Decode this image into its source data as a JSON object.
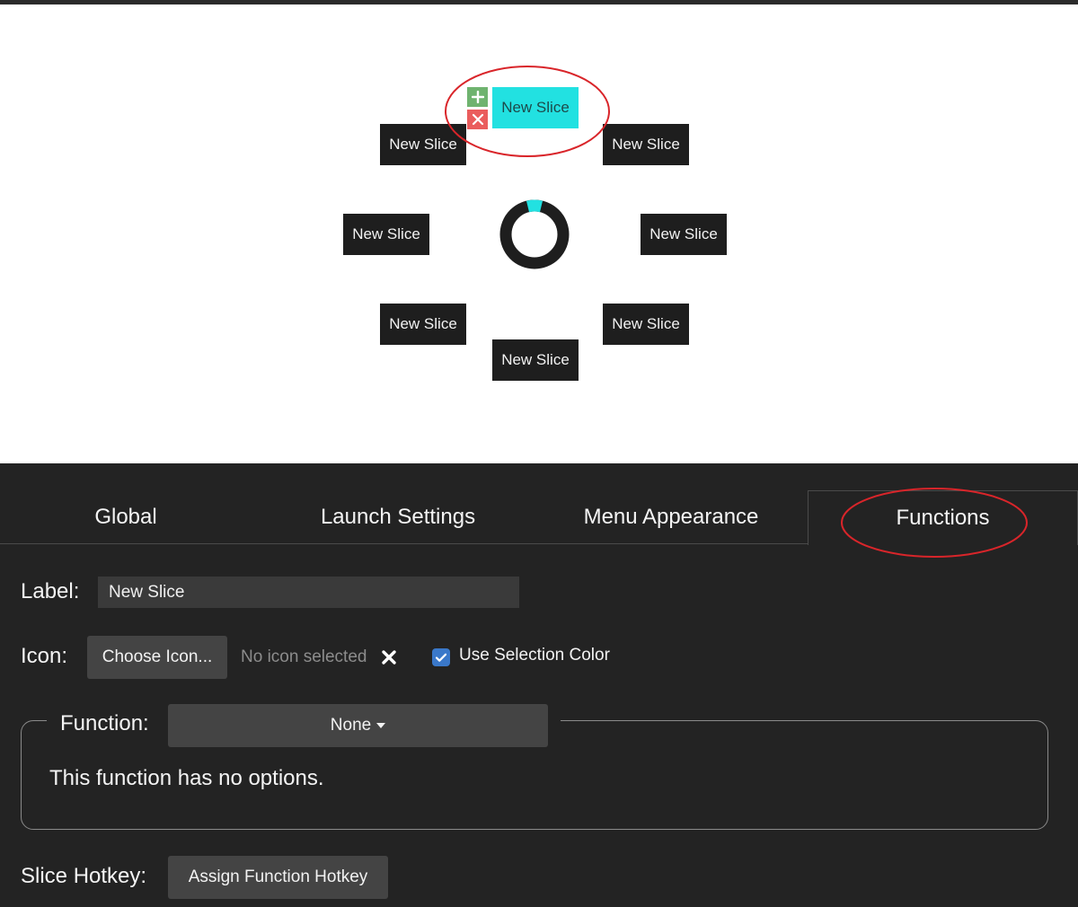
{
  "pie_menu": {
    "slices": [
      {
        "label": "New Slice",
        "selected": true
      },
      {
        "label": "New Slice"
      },
      {
        "label": "New Slice"
      },
      {
        "label": "New Slice"
      },
      {
        "label": "New Slice"
      },
      {
        "label": "New Slice"
      },
      {
        "label": "New Slice"
      },
      {
        "label": "New Slice"
      }
    ],
    "tools": {
      "add_icon": "plus-icon",
      "remove_icon": "close-icon"
    },
    "colors": {
      "selection": "#22e1e1",
      "slice_bg": "#1e1e1e",
      "ring": "#1e1e1e",
      "annotation": "#d9252a"
    }
  },
  "tabs": [
    {
      "label": "Global"
    },
    {
      "label": "Launch Settings"
    },
    {
      "label": "Menu Appearance"
    },
    {
      "label": "Functions",
      "active": true
    }
  ],
  "form": {
    "label_caption": "Label:",
    "label_value": "New Slice",
    "icon_caption": "Icon:",
    "choose_icon_button": "Choose Icon...",
    "no_icon_text": "No icon selected",
    "use_selection_color_label": "Use Selection Color",
    "use_selection_color_checked": true,
    "function_caption": "Function:",
    "function_value": "None",
    "function_note": "This function has no options.",
    "hotkey_caption": "Slice Hotkey:",
    "assign_hotkey_button": "Assign Function Hotkey"
  }
}
